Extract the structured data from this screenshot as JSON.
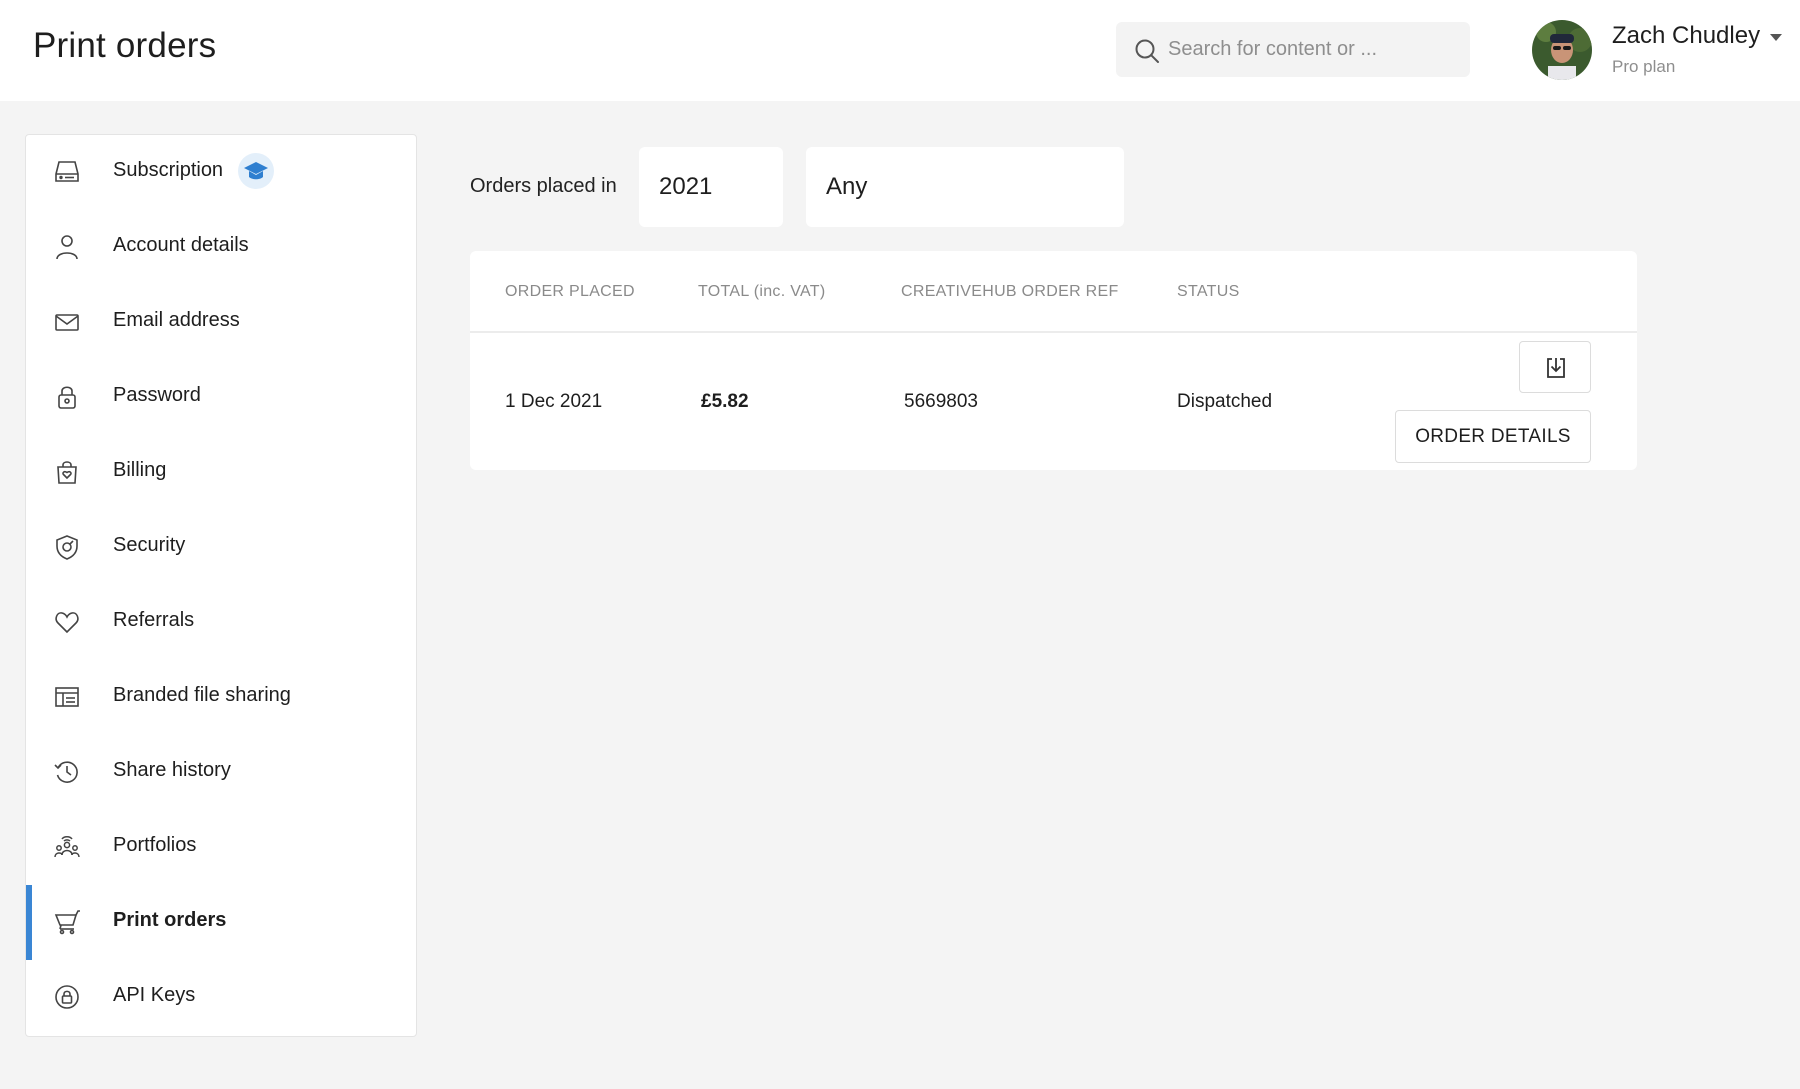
{
  "header": {
    "title": "Print orders",
    "search": {
      "placeholder": "Search for content or ...",
      "value": ""
    },
    "user": {
      "name": "Zach Chudley",
      "plan": "Pro plan"
    }
  },
  "sidebar": {
    "items": [
      {
        "label": "Subscription",
        "icon": "drive-icon",
        "badge_icon": "graduation-cap-icon"
      },
      {
        "label": "Account details",
        "icon": "person-icon"
      },
      {
        "label": "Email address",
        "icon": "envelope-icon"
      },
      {
        "label": "Password",
        "icon": "lock-icon"
      },
      {
        "label": "Billing",
        "icon": "shopping-bag-heart-icon"
      },
      {
        "label": "Security",
        "icon": "shield-icon"
      },
      {
        "label": "Referrals",
        "icon": "heart-icon"
      },
      {
        "label": "Branded file sharing",
        "icon": "layout-icon"
      },
      {
        "label": "Share history",
        "icon": "history-clock-icon"
      },
      {
        "label": "Portfolios",
        "icon": "people-group-icon"
      },
      {
        "label": "Print orders",
        "icon": "shopping-cart-icon",
        "active": true
      },
      {
        "label": "API Keys",
        "icon": "lock-circle-icon"
      }
    ]
  },
  "filters": {
    "label": "Orders placed in",
    "year": "2021",
    "status": "Any"
  },
  "orders": {
    "columns": [
      "ORDER PLACED",
      "TOTAL (inc. VAT)",
      "CREATIVEHUB ORDER REF",
      "STATUS"
    ],
    "rows": [
      {
        "date": "1 Dec 2021",
        "total": "£5.82",
        "ref": "5669803",
        "status": "Dispatched",
        "details_label": "ORDER DETAILS"
      }
    ]
  },
  "colors": {
    "accent": "#3a86d4",
    "background": "#f4f4f4"
  }
}
